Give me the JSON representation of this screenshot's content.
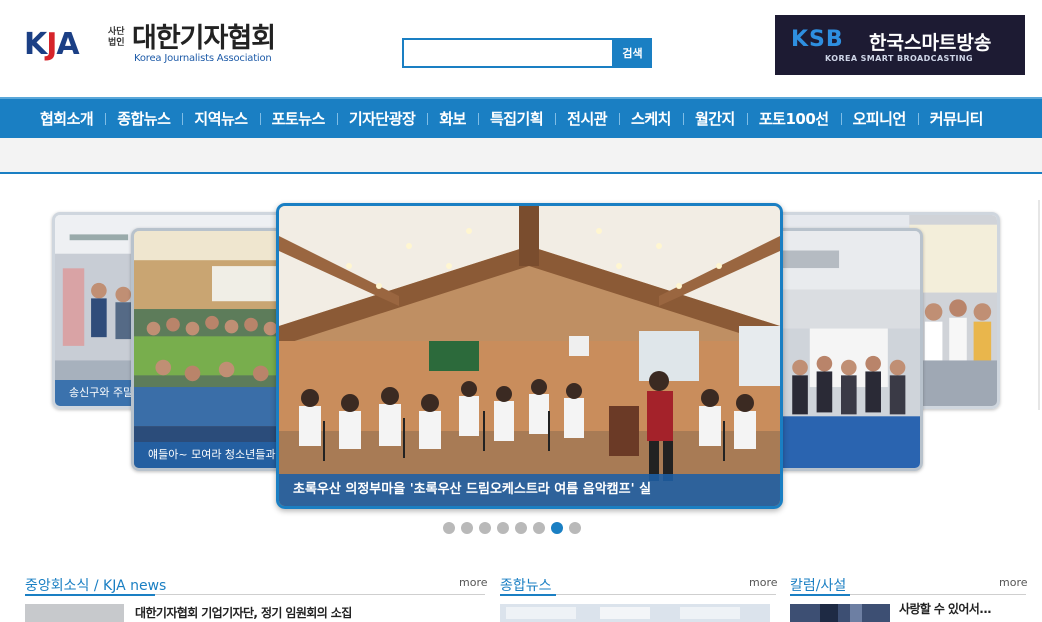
{
  "header": {
    "logo_kja": [
      "K",
      "J",
      "A"
    ],
    "logo_org": "사단 법인",
    "logo_name": "대한기자협회",
    "logo_eng": "Korea Journalists Association",
    "search_placeholder": "",
    "search_button": "검색",
    "banner": {
      "logo": "KSB",
      "name": "한국스마트방송",
      "eng": "KOREA SMART BROADCASTING"
    }
  },
  "nav": {
    "items": [
      "협회소개",
      "종합뉴스",
      "지역뉴스",
      "포토뉴스",
      "기자단광장",
      "화보",
      "특집기획",
      "전시관",
      "스케치",
      "월간지",
      "포토100선",
      "오피니언",
      "커뮤니티"
    ]
  },
  "slider": {
    "center_caption": "초록우산 의정부마을 '초록우산 드림오케스트라 여름 음악캠프' 실",
    "left_caption": "얘들아~ 모여라 청소년들과 함",
    "far_left_caption": "송신구와 주말가족",
    "dots_total": 8,
    "active_dot": 7
  },
  "sections": {
    "central": {
      "title": "중앙회소식 / KJA news",
      "more": "more",
      "headline": "대한기자협회 기업기자단, 정기 임원회의 소집"
    },
    "general": {
      "title": "종합뉴스",
      "more": "more"
    },
    "column": {
      "title": "칼럼/사설",
      "more": "more",
      "headline": "사랑할 수 있어서..."
    }
  },
  "colors": {
    "primary_blue": "#1a7fc3",
    "banner_dark": "#1d1b33",
    "kja_red": "#d6242a",
    "kja_navy": "#1b3f85"
  }
}
